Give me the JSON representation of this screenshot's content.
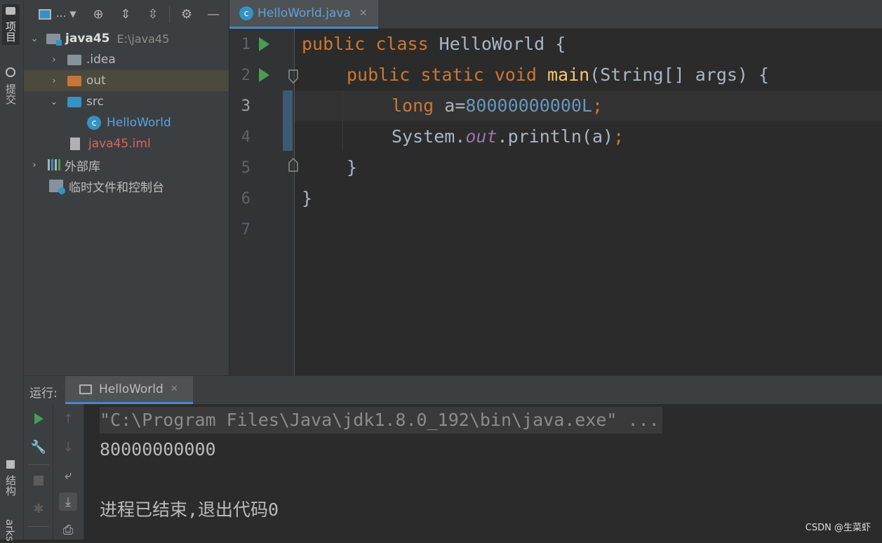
{
  "sidebar_labels": {
    "project": "项目",
    "commit": "提交",
    "structure": "结构",
    "bookmarks": "arks"
  },
  "project_tree": {
    "root": {
      "name": "java45",
      "path": "E:\\java45"
    },
    "items": [
      {
        "label": ".idea"
      },
      {
        "label": "out"
      },
      {
        "label": "src"
      },
      {
        "label": "HelloWorld"
      },
      {
        "label": "java45.iml"
      },
      {
        "label": "外部库"
      },
      {
        "label": "临时文件和控制台"
      }
    ],
    "toolbar_dots": "..."
  },
  "editor": {
    "tab_label": "HelloWorld.java",
    "line_numbers": [
      "1",
      "2",
      "3",
      "4",
      "5",
      "6",
      "7"
    ],
    "code": {
      "l1_kw": "public class ",
      "l1_rest": "HelloWorld {",
      "l2_kw": "public static void ",
      "l2_fn": "main",
      "l2_rest": "(String[] args) {",
      "l3_kw": "long ",
      "l3_var": "a=",
      "l3_num": "80000000000L",
      "l3_semi": ";",
      "l4_a": "System.",
      "l4_field": "out",
      "l4_b": ".println(a)",
      "l4_semi": ";",
      "l5": "}",
      "l6": "}"
    }
  },
  "run_panel": {
    "label": "运行:",
    "tab_label": "HelloWorld",
    "console": [
      "\"C:\\Program Files\\Java\\jdk1.8.0_192\\bin\\java.exe\" ...",
      "80000000000",
      "进程已结束,退出代码0"
    ]
  },
  "watermark": "CSDN @生菜虾",
  "colors": {
    "keyword": "#cc7832",
    "number": "#6897bb",
    "function": "#ffc66d",
    "field": "#9876aa",
    "run_green": "#499c54",
    "selection": "#4b4a3c"
  }
}
